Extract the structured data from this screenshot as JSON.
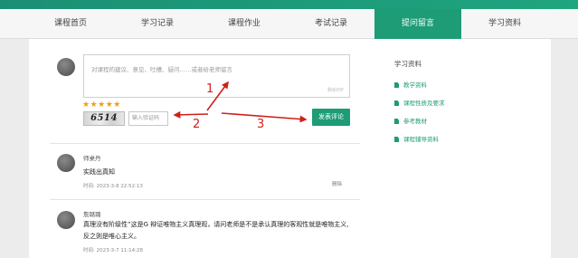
{
  "nav": {
    "items": [
      {
        "label": "课程首页",
        "active": false
      },
      {
        "label": "学习记录",
        "active": false
      },
      {
        "label": "课程作业",
        "active": false
      },
      {
        "label": "考试记录",
        "active": false
      },
      {
        "label": "提问留言",
        "active": true
      },
      {
        "label": "学习资料",
        "active": false
      }
    ]
  },
  "compose": {
    "placeholder": "对课程的建议、意见、吐槽、疑问……或者给老师留言",
    "char_count": "剩余0字",
    "stars": "★★★★★",
    "captcha_text": "6514",
    "captcha_placeholder": "输入验证码",
    "submit_label": "发表评论"
  },
  "comments": [
    {
      "name": "师桌丹",
      "text": "实践出真知",
      "time": "时间: 2023-3-8 22:52:13",
      "delete_label": "删除"
    },
    {
      "name": "詹璐璐",
      "text_line1": "真理没有阶级性”这是G 辩证唯物主义真理观，请问老师是不是承认真理的客观性就是唯物主义,",
      "text_line2": "反之则是唯心主义。",
      "time": "时间: 2023-3-7 11:14:28"
    }
  ],
  "sidebar": {
    "title": "学习资料",
    "items": [
      "教学资料",
      "课程性质及要求",
      "参考教材",
      "课程辅导资料"
    ]
  },
  "annotations": {
    "one": "1",
    "two": "2",
    "three": "3"
  },
  "colors": {
    "accent": "#1d9c76",
    "arrow": "#d0201a",
    "star": "#f39c12"
  }
}
